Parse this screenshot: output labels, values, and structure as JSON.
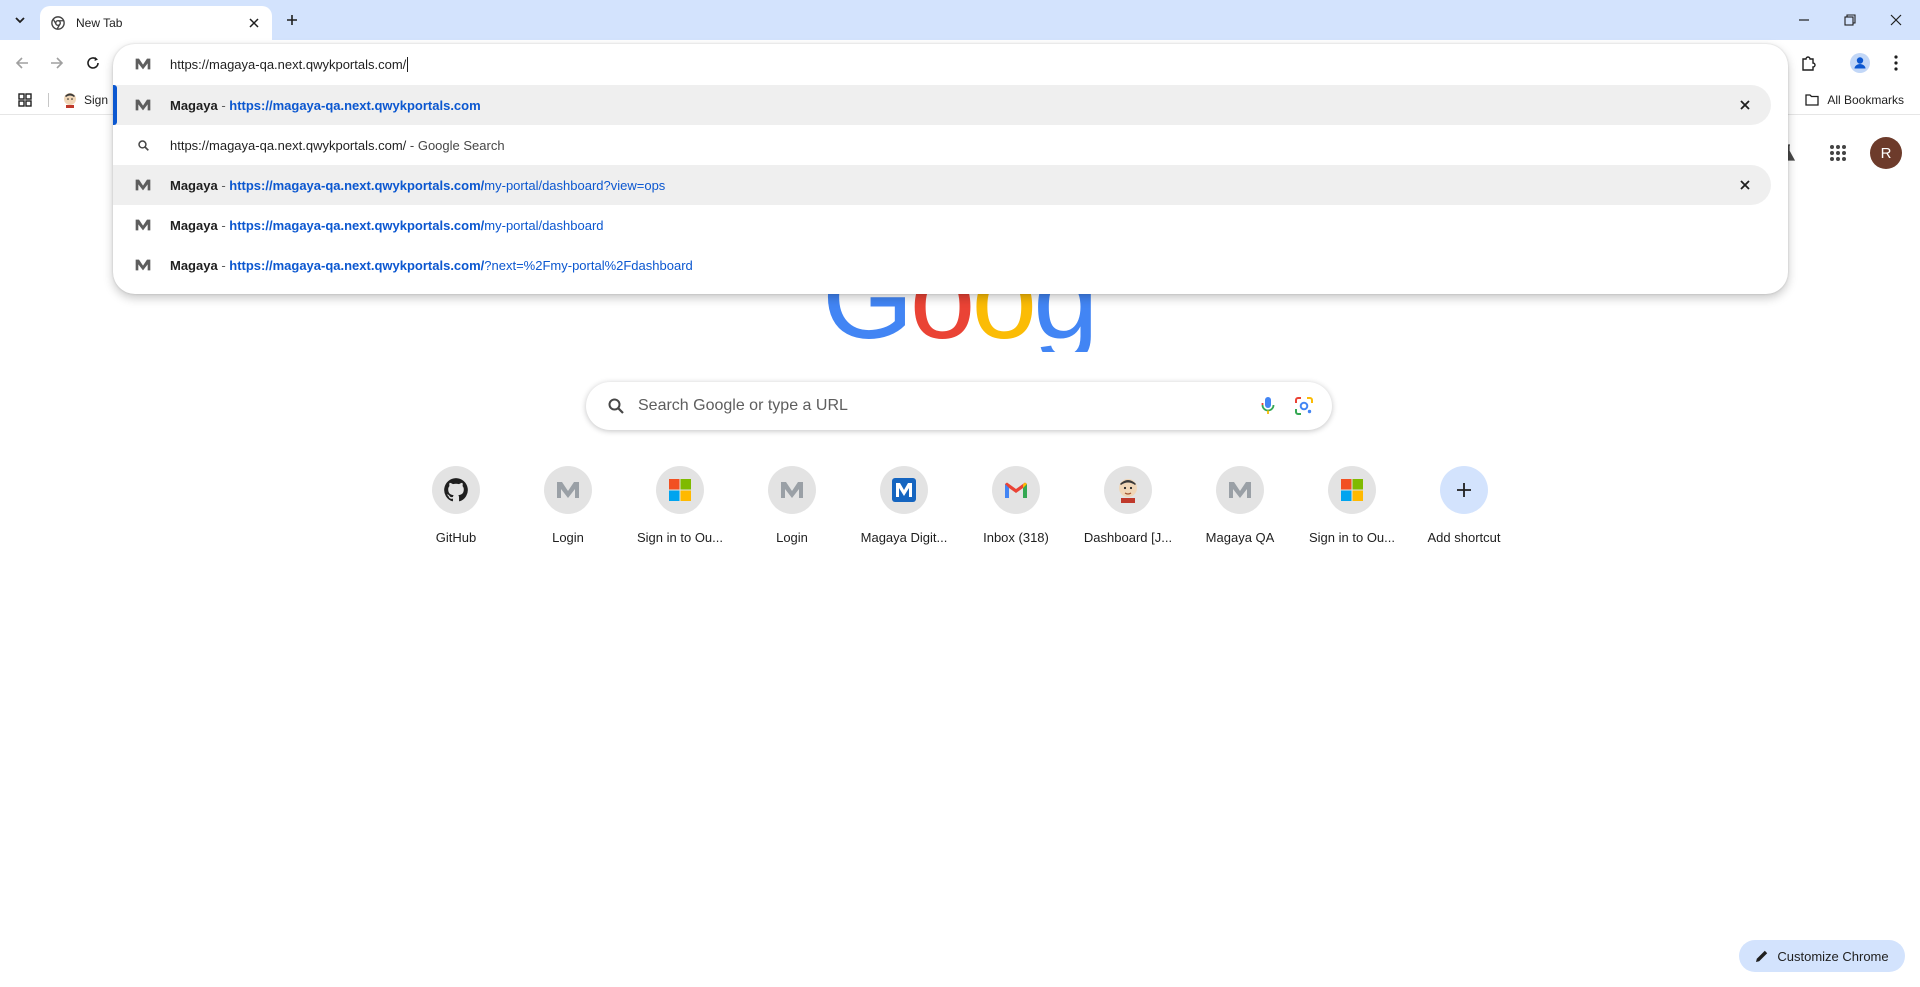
{
  "window": {
    "tab_title": "New Tab"
  },
  "bookmarks": {
    "first_item": "Sign",
    "all_bookmarks": "All Bookmarks"
  },
  "omnibox": {
    "input_value": "https://magaya-qa.next.qwykportals.com/",
    "suggestions": [
      {
        "title": "Magaya",
        "dash": " - ",
        "url_bold": "https://magaya-qa.next.qwykportals.com",
        "url_rest": "",
        "removable": true,
        "selected": true
      },
      {
        "text": "https://magaya-qa.next.qwykportals.com/",
        "suffix": " - Google Search"
      },
      {
        "title": "Magaya",
        "dash": " - ",
        "url_bold": "https://magaya-qa.next.qwykportals.com/",
        "url_rest": "my-portal/dashboard?view=ops",
        "removable": true
      },
      {
        "title": "Magaya",
        "dash": " - ",
        "url_bold": "https://magaya-qa.next.qwykportals.com/",
        "url_rest": "my-portal/dashboard",
        "removable": false
      },
      {
        "title": "Magaya",
        "dash": " - ",
        "url_bold": "https://magaya-qa.next.qwykportals.com/",
        "url_rest": "?next=%2Fmy-portal%2Fdashboard",
        "removable": false
      }
    ]
  },
  "profile": {
    "initial": "R"
  },
  "search": {
    "placeholder": "Search Google or type a URL"
  },
  "shortcuts": [
    {
      "label": "GitHub",
      "icon": "github-icon"
    },
    {
      "label": "Login",
      "icon": "magaya-m-icon"
    },
    {
      "label": "Sign in to Ou...",
      "icon": "microsoft-icon"
    },
    {
      "label": "Login",
      "icon": "magaya-m-icon"
    },
    {
      "label": "Magaya Digit...",
      "icon": "magaya-blue-icon"
    },
    {
      "label": "Inbox (318)",
      "icon": "gmail-icon"
    },
    {
      "label": "Dashboard [J...",
      "icon": "jenkins-icon"
    },
    {
      "label": "Magaya QA",
      "icon": "magaya-m-icon"
    },
    {
      "label": "Sign in to Ou...",
      "icon": "microsoft-icon"
    },
    {
      "label": "Add shortcut",
      "icon": "plus-icon"
    }
  ],
  "customize": {
    "label": "Customize Chrome"
  },
  "colors": {
    "tabstrip": "#d3e3fd",
    "accent": "#0b57d0",
    "highlight_row": "#efefef"
  }
}
